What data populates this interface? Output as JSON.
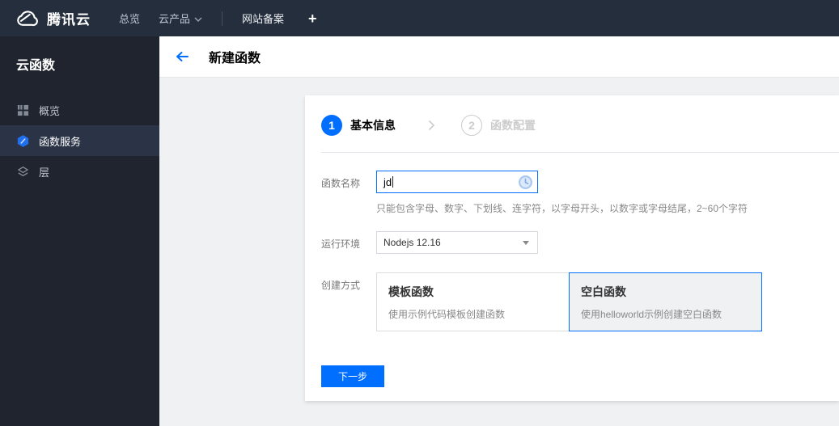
{
  "colors": {
    "accent": "#006eff",
    "topbar_bg": "#252e3c",
    "sidebar_bg": "#1f242e",
    "sidebar_selected_bg": "#2b3447",
    "content_bg": "#f0f1f2",
    "selected_card_bg": "#f0f1f3"
  },
  "topbar": {
    "brand": "腾讯云",
    "nav": {
      "overview": "总览",
      "cloud_products": "云产品",
      "icp_filing": "网站备案",
      "add_tab": "+"
    }
  },
  "sidebar": {
    "title": "云函数",
    "items": [
      {
        "label": "概览",
        "icon": "overview-grid-icon",
        "selected": false
      },
      {
        "label": "函数服务",
        "icon": "function-service-icon",
        "selected": true
      },
      {
        "label": "层",
        "icon": "layers-icon",
        "selected": false
      }
    ]
  },
  "page_header": {
    "title": "新建函数"
  },
  "wizard": {
    "steps": [
      {
        "number": "1",
        "label": "基本信息",
        "state": "active"
      },
      {
        "number": "2",
        "label": "函数配置",
        "state": "upcoming"
      }
    ]
  },
  "form": {
    "function_name": {
      "label": "函数名称",
      "value": "jd",
      "help": "只能包含字母、数字、下划线、连字符，以字母开头，以数字或字母结尾，2~60个字符"
    },
    "runtime": {
      "label": "运行环境",
      "value": "Nodejs 12.16"
    },
    "creation_method": {
      "label": "创建方式",
      "options": [
        {
          "title": "模板函数",
          "desc": "使用示例代码模板创建函数",
          "selected": false
        },
        {
          "title": "空白函数",
          "desc": "使用helloworld示例创建空白函数",
          "selected": true
        }
      ]
    }
  },
  "actions": {
    "next": "下一步"
  }
}
